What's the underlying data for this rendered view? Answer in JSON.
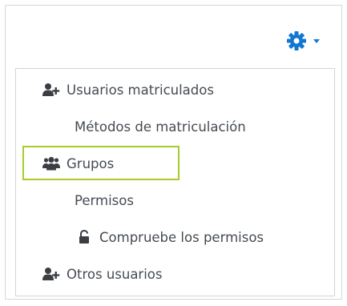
{
  "toolbar": {
    "gear_icon": "gear-icon",
    "caret_icon": "chevron-down-icon",
    "accent_color": "#1177d1"
  },
  "menu": {
    "items": [
      {
        "label": "Usuarios matriculados",
        "icon": "user-plus-icon"
      },
      {
        "label": "Métodos de matriculación",
        "icon": ""
      },
      {
        "label": "Grupos",
        "icon": "users-icon",
        "highlighted": true
      },
      {
        "label": "Permisos",
        "icon": ""
      },
      {
        "label": "Compruebe los permisos",
        "icon": "unlock-icon"
      },
      {
        "label": "Otros usuarios",
        "icon": "user-plus-icon"
      }
    ],
    "highlight_color": "#a9cc2a"
  }
}
